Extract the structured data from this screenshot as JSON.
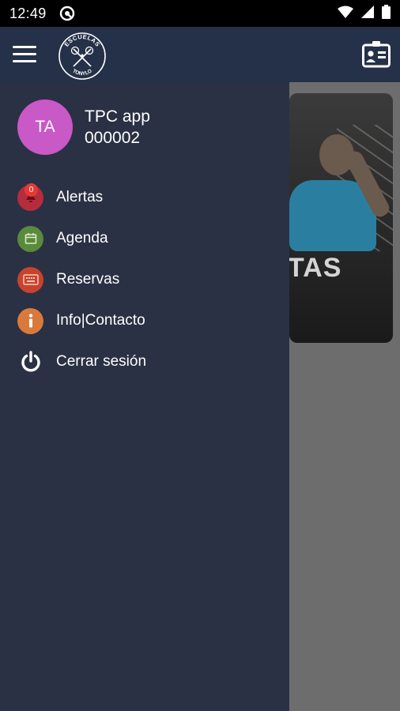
{
  "status_bar": {
    "time": "12:49",
    "icons": [
      "notification-icon",
      "wifi-icon",
      "signal-icon",
      "battery-icon"
    ]
  },
  "app_bar": {
    "logo_text_top": "ESCUELAS",
    "logo_text_bottom": "TONYLO",
    "icons": [
      "hamburger-menu-icon",
      "id-card-icon"
    ]
  },
  "background": {
    "card_title": "TAS"
  },
  "drawer": {
    "profile": {
      "initials": "TA",
      "name": "TPC app",
      "id": "000002",
      "avatar_color": "#c859c6"
    },
    "items": [
      {
        "label": "Alertas",
        "icon": "alert-icon",
        "color": "#b52c3c",
        "badge": "0"
      },
      {
        "label": "Agenda",
        "icon": "calendar-icon",
        "color": "#5a8a3c"
      },
      {
        "label": "Reservas",
        "icon": "keyboard-icon",
        "color": "#c8432e"
      },
      {
        "label": "Info|Contacto",
        "icon": "info-icon",
        "color": "#d97a3c"
      },
      {
        "label": "Cerrar sesión",
        "icon": "power-icon",
        "color": "#ffffff"
      }
    ]
  },
  "colors": {
    "app_bar": "#253148",
    "drawer": "#2a3144",
    "scrim": "#6d6d6d"
  }
}
